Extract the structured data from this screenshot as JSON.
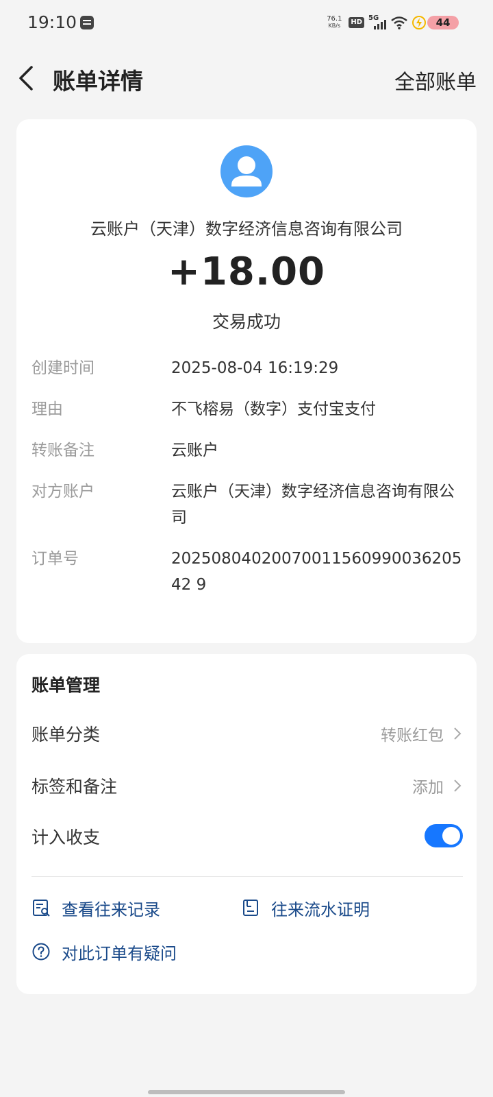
{
  "status_bar": {
    "time": "19:10",
    "net_speed_value": "76.1",
    "net_speed_unit": "KB/s",
    "hd": "HD",
    "network": "5G",
    "battery": "44"
  },
  "header": {
    "title": "账单详情",
    "all_bills": "全部账单"
  },
  "transaction": {
    "merchant": "云账户（天津）数字经济信息咨询有限公司",
    "amount": "+18.00",
    "status": "交易成功",
    "details": [
      {
        "label": "创建时间",
        "value": "2025-08-04 16:19:29"
      },
      {
        "label": "理由",
        "value": "不飞榕易（数字）支付宝支付"
      },
      {
        "label": "转账备注",
        "value": "云账户"
      },
      {
        "label": "对方账户",
        "value": "云账户（天津）数字经济信息咨询有限公司"
      },
      {
        "label": "订单号",
        "value": "2025080402007001156099003620542 9"
      }
    ]
  },
  "manage": {
    "title": "账单管理",
    "category_label": "账单分类",
    "category_value": "转账红包",
    "tags_label": "标签和备注",
    "tags_value": "添加",
    "count_label": "计入收支",
    "count_enabled": true,
    "links": {
      "records": "查看往来记录",
      "proof": "往来流水证明",
      "question": "对此订单有疑问"
    }
  },
  "colors": {
    "accent": "#1677ff",
    "avatar": "#4ea3f7",
    "link": "#1a4a8a"
  }
}
